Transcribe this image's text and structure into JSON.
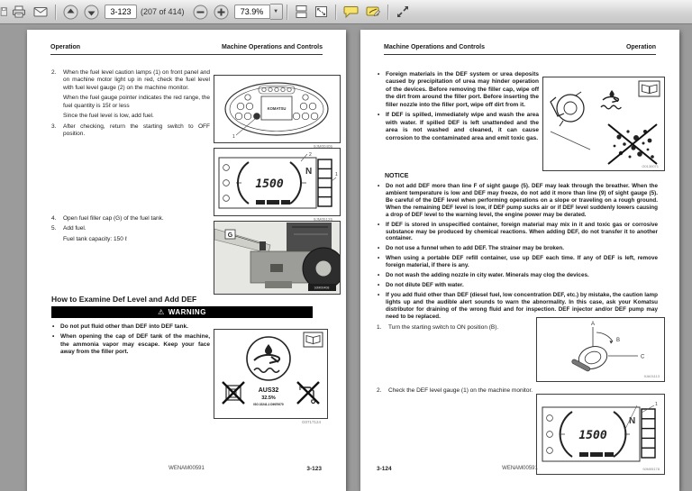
{
  "ui": {
    "bullet": "•",
    "warning_icon": "⚠",
    "dropdown_arrow": "▼"
  },
  "toolbar": {
    "page_field": "3-123",
    "page_count": "(207 of 414)",
    "zoom_value": "73.9%"
  },
  "left_page": {
    "header_left": "Operation",
    "header_right": "Machine Operations and Controls",
    "items": [
      {
        "num": "2.",
        "text": "When the fuel level caution lamps (1) on front panel and on machine motor light up in red, check the fuel level with fuel level gauge (2) on the machine monitor.",
        "sub1": "When the fuel gauge pointer indicates the red range, the fuel quantity is 15ℓ or less",
        "sub2": "Since the fuel level is low, add fuel."
      },
      {
        "num": "3.",
        "text": "After checking, return the starting switch to OFF position."
      },
      {
        "num": "4.",
        "text": "Open fuel filler cap (G) of the fuel tank."
      },
      {
        "num": "5.",
        "text": "Add fuel.",
        "sub1": "Fuel tank capacity: 150 ℓ"
      }
    ],
    "section_heading": "How to Examine Def Level and Add DEF",
    "warning": {
      "label": "WARNING",
      "bullets": [
        "Do not put fluid other than DEF into DEF tank.",
        "When opening the cap of DEF tank of the machine, the ammonia vapor may escape. Keep your face away from the filler port."
      ]
    },
    "figures": {
      "panel": {
        "brand": "KOMATSU",
        "callout": "1",
        "caption": "9JM00405"
      },
      "monitor": {
        "value": "1500",
        "gear": "N",
        "callout1": "1",
        "callout2": "2",
        "caption": "9JM05125"
      },
      "photo": {
        "label": "G",
        "caption": "9JM00408"
      },
      "aus32": {
        "title": "AUS32",
        "percent": "32.5%",
        "standard": "ISO 22241-1 DIN70070",
        "caption": "G0717124"
      }
    },
    "footer": {
      "code": "WENAM00591",
      "page": "3-123"
    }
  },
  "right_page": {
    "header_left": "Machine Operations and Controls",
    "header_right": "Operation",
    "bullets": [
      "Foreign materials in the DEF system or urea deposits caused by precipitation of urea may hinder operation of the devices. Before removing the filler cap, wipe off the dirt from around the filler port. Before inserting the filler nozzle into the filler port, wipe off dirt from it.",
      "If DEF is spilled, immediately wipe and wash the area with water. If spilled DEF is left unattended and the area is not washed and cleaned, it can cause corrosion to the contaminated area and emit toxic gas."
    ],
    "notice_label": "NOTICE",
    "notice_bullets": [
      "Do not add DEF more than line F of sight gauge (5). DEF may leak through the breather. When the ambient temperature is low and DEF may freeze, do not add it more than line (9) of sight gauge (5). Be careful of the DEF level when performing operations on a slope or traveling on a rough ground. When the remaining DEF level is low, if DEF pump sucks air or if DEF level suddenly lowers causing a drop of DEF level to the warning level, the engine power may be derated.",
      "If DEF is stored in unspecified container, foreign material may mix in it and toxic gas or corrosive substance may be produced by chemical reactions. When adding DEF, do not transfer it to another container.",
      "Do not use a funnel when to add DEF. The strainer may be broken.",
      "When using a portable DEF refill container, use up DEF each time. If any of DEF is left, remove foreign material, if there is any.",
      "Do not wash the adding nozzle in city water. Minerals may clog the devices.",
      "Do not dilute DEF with water.",
      "If you add fluid other than DEF (diesel fuel, low concentration DEF, etc.) by mistake, the caution lamp lights up and the audible alert sounds to warn the abnormality. In this case, ask your Komatsu distributor for draining of the wrong fluid and for inspection. DEF injector and/or DEF pump may need to be replaced."
    ],
    "steps": [
      {
        "num": "1.",
        "text": "Turn the starting switch to ON position (B)."
      },
      {
        "num": "2.",
        "text": "Check the DEF level gauge (1) on the machine monitor."
      }
    ],
    "figures": {
      "def": {
        "caption": "G0130071"
      },
      "switch": {
        "a": "A",
        "b": "B",
        "c": "C",
        "caption": "9JA01113"
      },
      "monitor": {
        "value": "1500",
        "gear": "N",
        "callout": "1",
        "caption": "9JM05178"
      }
    },
    "footer": {
      "page": "3-124",
      "code": "WENAM00591"
    }
  }
}
